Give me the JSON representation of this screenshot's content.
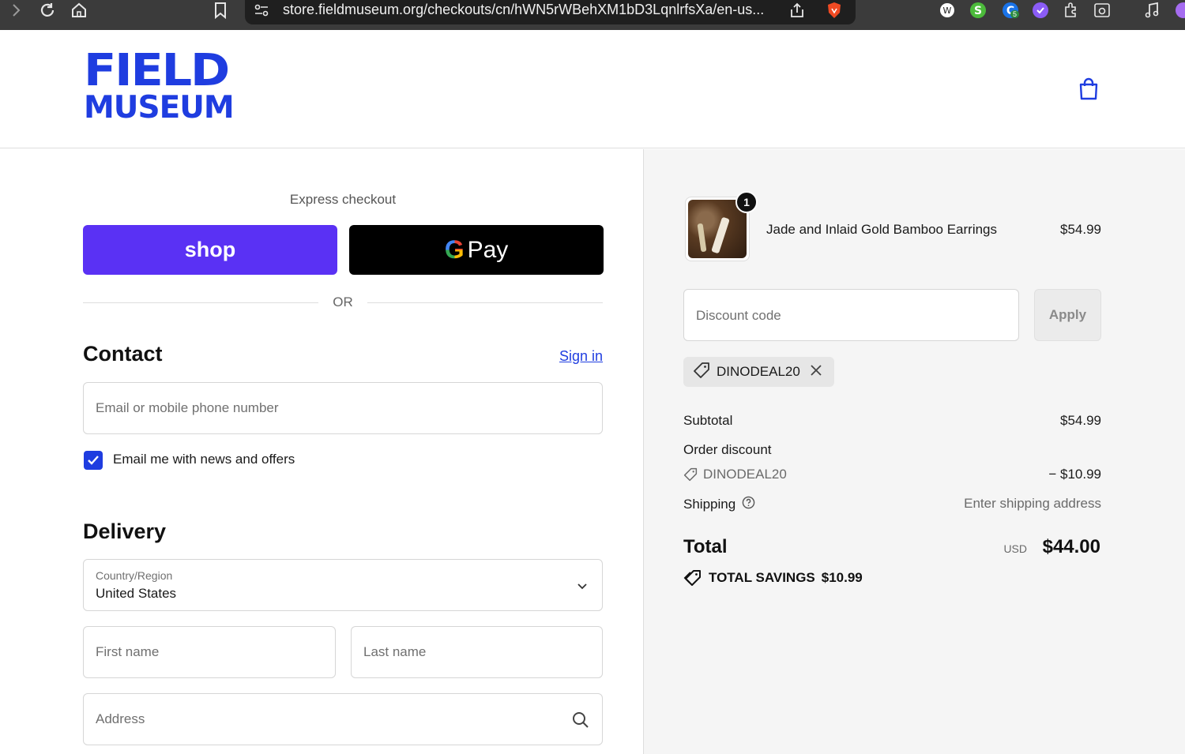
{
  "browser": {
    "url": "store.fieldmuseum.org/checkouts/cn/hWN5rWBehXM1bD3LqnlrfsXa/en-us...",
    "extension_badge": "5"
  },
  "header": {
    "logo_line1": "FIELD",
    "logo_line2": "MUSEUM"
  },
  "express": {
    "label": "Express checkout",
    "shop_label": "shop",
    "gpay_g": "G",
    "gpay_label": "Pay",
    "or_label": "OR"
  },
  "contact": {
    "title": "Contact",
    "signin_label": "Sign in",
    "email_placeholder": "Email or mobile phone number",
    "newsletter_label": "Email me with news and offers",
    "newsletter_checked": true
  },
  "delivery": {
    "title": "Delivery",
    "country_label": "Country/Region",
    "country_value": "United States",
    "first_name_placeholder": "First name",
    "last_name_placeholder": "Last name",
    "address_placeholder": "Address"
  },
  "order": {
    "item": {
      "name": "Jade and Inlaid Gold Bamboo Earrings",
      "price": "$54.99",
      "quantity": "1"
    },
    "discount_placeholder": "Discount code",
    "apply_label": "Apply",
    "applied_code": "DINODEAL20",
    "subtotal_label": "Subtotal",
    "subtotal_value": "$54.99",
    "order_discount_label": "Order discount",
    "discount_code_line": "DINODEAL20",
    "discount_value": "− $10.99",
    "shipping_label": "Shipping",
    "shipping_value": "Enter shipping address",
    "total_label": "Total",
    "currency": "USD",
    "total_value": "$44.00",
    "savings_label": "TOTAL SAVINGS",
    "savings_value": "$10.99"
  },
  "colors": {
    "brand_blue": "#1f3de0",
    "shop_purple": "#5a31f4"
  }
}
